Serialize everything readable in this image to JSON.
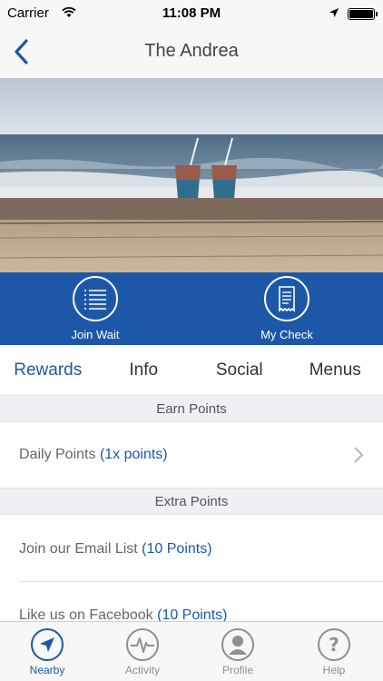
{
  "status_bar": {
    "carrier": "Carrier",
    "time": "11:08 PM"
  },
  "nav": {
    "title": "The Andrea"
  },
  "actions": {
    "join_wait": "Join Wait",
    "my_check": "My Check"
  },
  "tabs": [
    {
      "label": "Rewards",
      "active": true
    },
    {
      "label": "Info"
    },
    {
      "label": "Social"
    },
    {
      "label": "Menus"
    }
  ],
  "earn_points": {
    "header": "Earn Points",
    "daily": {
      "label": "Daily Points",
      "points": "(1x points)"
    }
  },
  "extra_points": {
    "header": "Extra Points",
    "items": [
      {
        "label": "Join our Email List",
        "points": "(10 Points)"
      },
      {
        "label": "Like us on Facebook",
        "points": "(10 Points)"
      }
    ]
  },
  "tab_bar": {
    "items": [
      {
        "label": "Nearby",
        "icon": "location-arrow-icon",
        "active": true
      },
      {
        "label": "Activity",
        "icon": "activity-icon"
      },
      {
        "label": "Profile",
        "icon": "profile-icon"
      },
      {
        "label": "Help",
        "icon": "help-icon"
      }
    ]
  },
  "colors": {
    "accent": "#1d58a8",
    "background": "#efeff4",
    "inactive": "#8e8e93"
  }
}
